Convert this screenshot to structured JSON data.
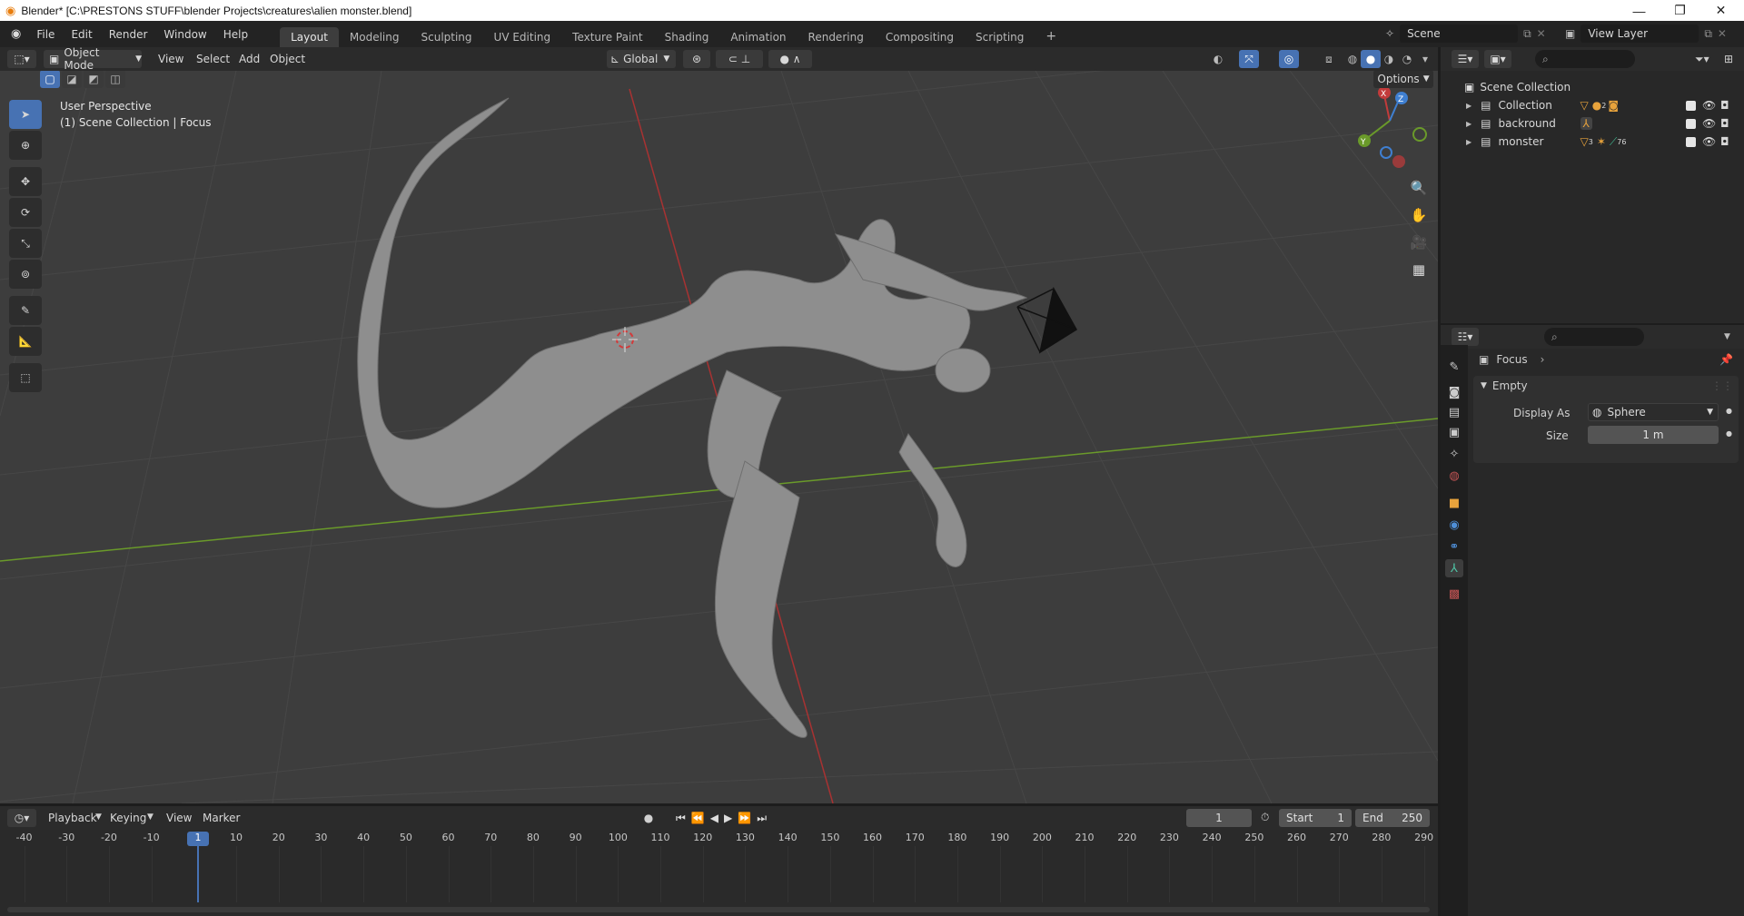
{
  "window": {
    "title": "Blender* [C:\\PRESTONS STUFF\\blender Projects\\creatures\\alien monster.blend]"
  },
  "menu": [
    "File",
    "Edit",
    "Render",
    "Window",
    "Help"
  ],
  "workspaces": [
    "Layout",
    "Modeling",
    "Sculpting",
    "UV Editing",
    "Texture Paint",
    "Shading",
    "Animation",
    "Rendering",
    "Compositing",
    "Scripting"
  ],
  "active_workspace": "Layout",
  "scene": {
    "name": "Scene",
    "view_layer": "View Layer"
  },
  "viewport_header": {
    "mode": "Object Mode",
    "menus": [
      "View",
      "Select",
      "Add",
      "Object"
    ],
    "orientation": "Global",
    "options_label": "Options"
  },
  "viewport": {
    "perspective": "User Perspective",
    "context": "(1) Scene Collection | Focus",
    "axes": {
      "x": "X",
      "y": "Y",
      "z": "Z"
    }
  },
  "outliner": {
    "root": "Scene Collection",
    "items": [
      {
        "name": "Collection",
        "badge": "2"
      },
      {
        "name": "backround",
        "badge": ""
      },
      {
        "name": "monster",
        "badge": "3",
        "badge2": "76"
      }
    ]
  },
  "properties": {
    "object_name": "Focus",
    "panel_title": "Empty",
    "display_as_label": "Display As",
    "display_as_value": "Sphere",
    "size_label": "Size",
    "size_value": "1 m"
  },
  "timeline": {
    "menus": [
      "Playback",
      "Keying",
      "View",
      "Marker"
    ],
    "current_frame": "1",
    "start_label": "Start",
    "start_value": "1",
    "end_label": "End",
    "end_value": "250",
    "ticks": [
      "-40",
      "-30",
      "-20",
      "-10",
      "1",
      "10",
      "20",
      "30",
      "40",
      "50",
      "60",
      "70",
      "80",
      "90",
      "100",
      "110",
      "120",
      "130",
      "140",
      "150",
      "160",
      "170",
      "180",
      "190",
      "200",
      "210",
      "220",
      "230",
      "240",
      "250",
      "260",
      "270",
      "280",
      "290"
    ]
  },
  "colors": {
    "accent": "#4772b3",
    "x_axis": "#c23b3b",
    "y_axis": "#6a9a2a",
    "z_axis": "#3f7fd1"
  }
}
